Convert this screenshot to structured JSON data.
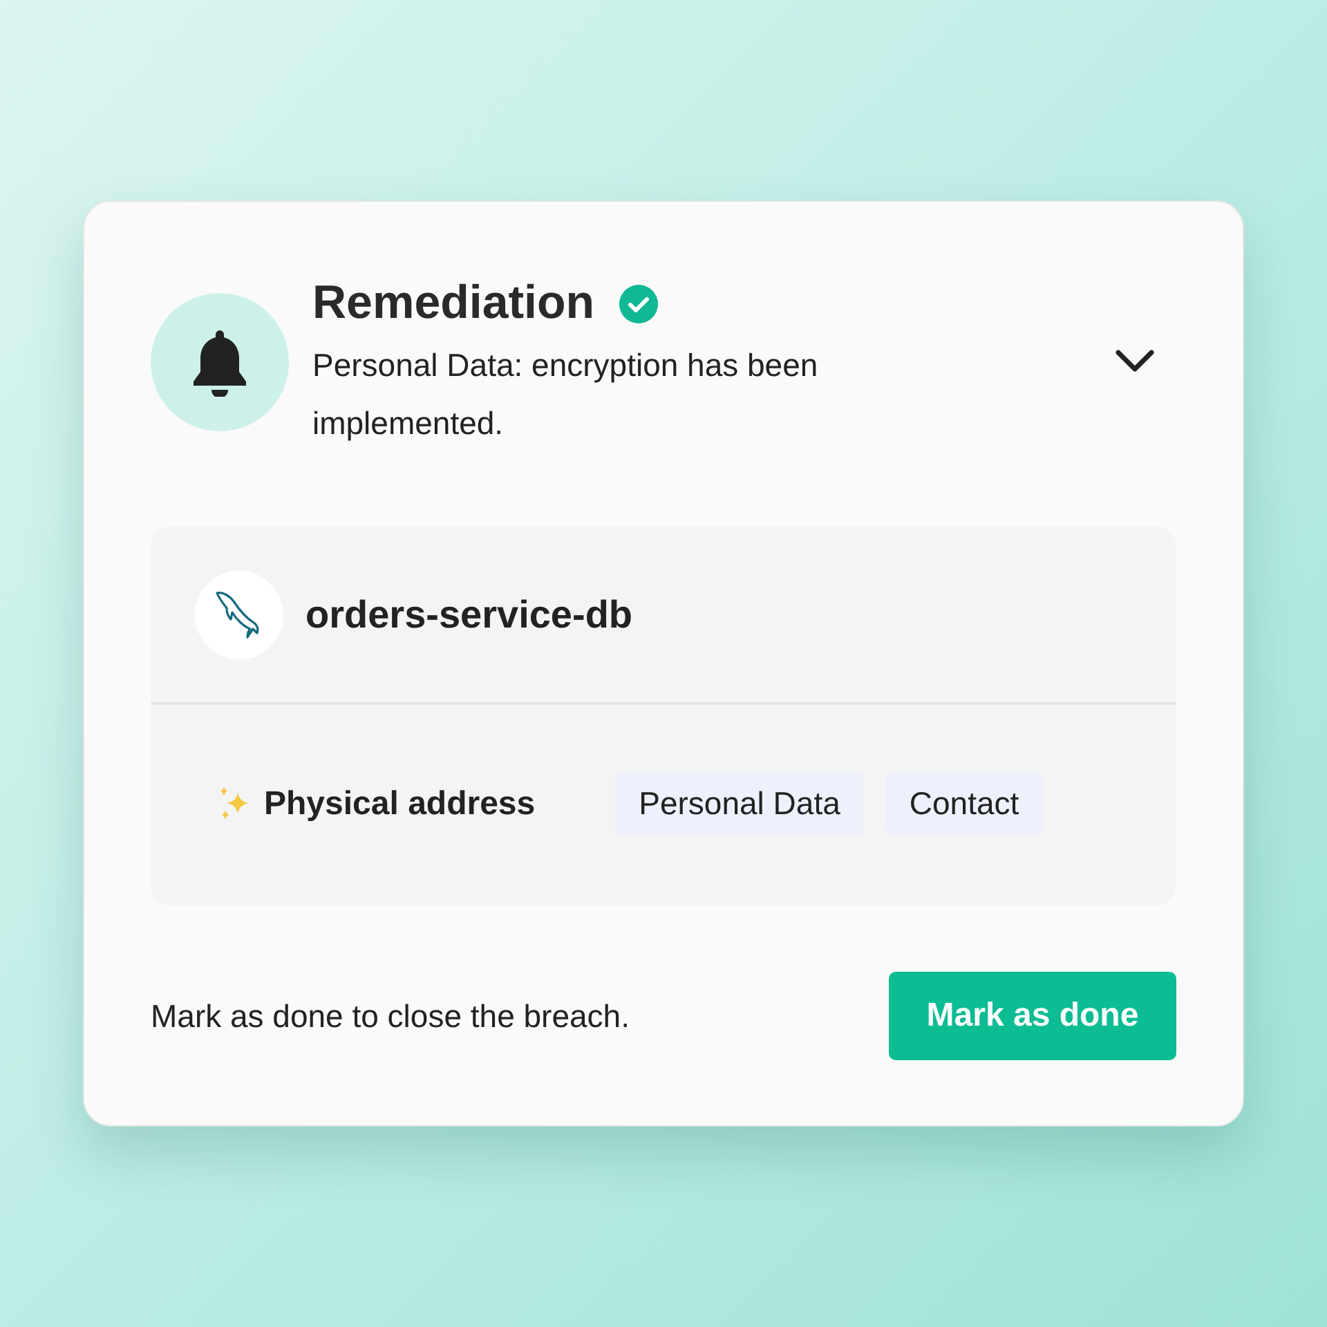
{
  "remediation": {
    "title": "Remediation",
    "description": "Personal Data: encryption has been implemented."
  },
  "resource": {
    "name": "orders-service-db"
  },
  "finding": {
    "label": "Physical address",
    "tags": [
      "Personal Data",
      "Contact"
    ]
  },
  "footer": {
    "hint": "Mark as done to close the breach.",
    "button": "Mark as done"
  }
}
